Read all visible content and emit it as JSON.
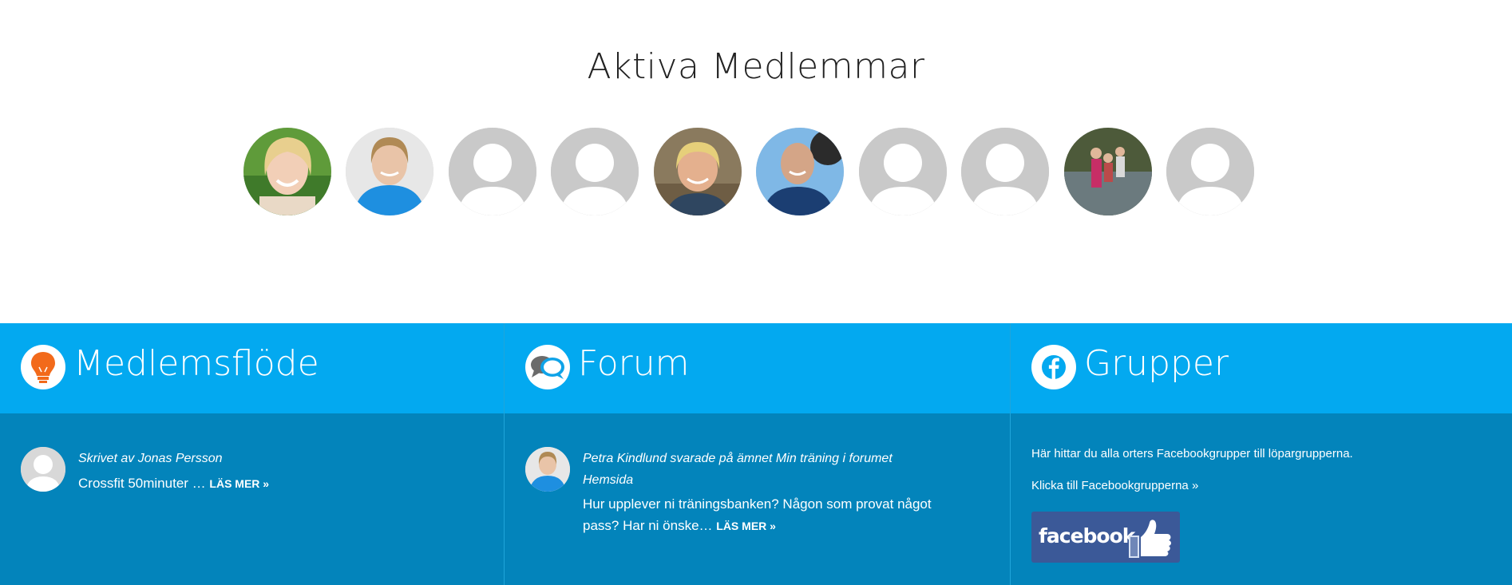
{
  "members": {
    "title": "Aktiva Medlemmar",
    "avatars": [
      {
        "kind": "photo",
        "description": "smiling-blonde-woman"
      },
      {
        "kind": "photo",
        "description": "woman-blue-jacket"
      },
      {
        "kind": "placeholder"
      },
      {
        "kind": "placeholder"
      },
      {
        "kind": "photo",
        "description": "woman-outdoors"
      },
      {
        "kind": "photo",
        "description": "man-blue-shirt"
      },
      {
        "kind": "placeholder"
      },
      {
        "kind": "placeholder"
      },
      {
        "kind": "photo",
        "description": "group-in-water"
      },
      {
        "kind": "placeholder"
      }
    ]
  },
  "panels": {
    "feed": {
      "title": "Medlemsflöde",
      "icon": "lightbulb-icon",
      "meta": "Skrivet av Jonas Persson",
      "excerpt": "Crossfit 50minuter …",
      "read_more": "LÄS MER »"
    },
    "forum": {
      "title": "Forum",
      "icon": "speech-bubbles-icon",
      "meta_line1": "Petra Kindlund svarade på ämnet Min träning i forumet",
      "meta_line2": "Hemsida",
      "excerpt_line1": "Hur upplever ni träningsbanken? Någon som provat något",
      "excerpt_line2": "pass? Har ni önske…",
      "read_more": "LÄS MER »"
    },
    "groups": {
      "title": "Grupper",
      "icon": "facebook-icon",
      "description": "Här hittar du alla orters Facebookgrupper till löpargrupperna.",
      "link": "Klicka till Facebookgrupperna »",
      "badge_text": "facebook"
    }
  },
  "colors": {
    "header_blue": "#03a9f0",
    "body_blue": "#0384bb",
    "placeholder_gray": "#c9c9c9",
    "facebook_blue": "#3b5998",
    "bulb_orange": "#f26a1b"
  }
}
